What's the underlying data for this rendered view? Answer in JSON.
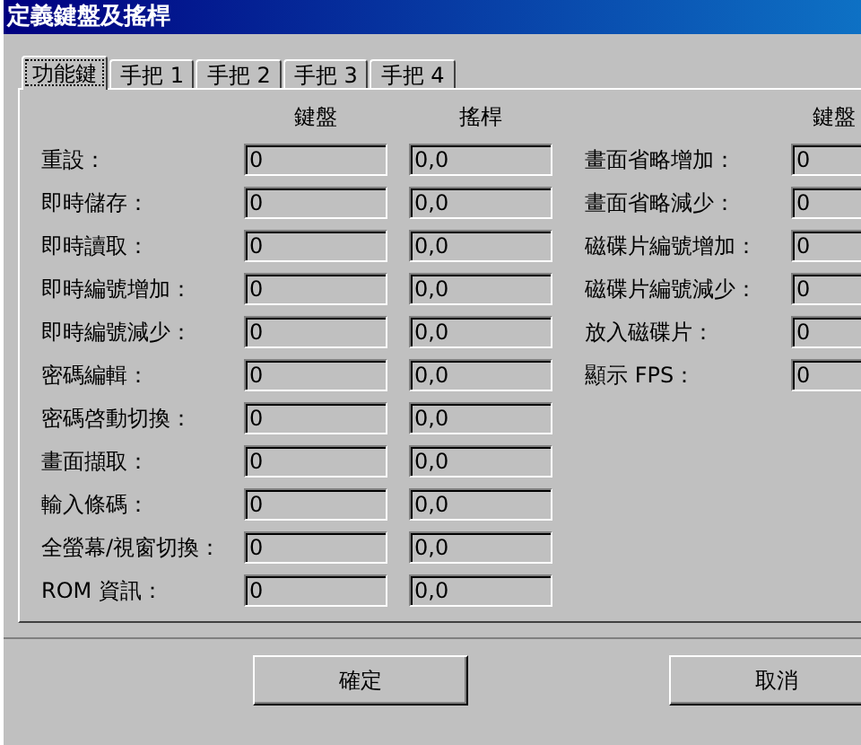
{
  "window": {
    "title": "定義鍵盤及搖桿"
  },
  "tabs": [
    {
      "label": "功能鍵",
      "selected": true
    },
    {
      "label": "手把 1",
      "selected": false
    },
    {
      "label": "手把 2",
      "selected": false
    },
    {
      "label": "手把 3",
      "selected": false
    },
    {
      "label": "手把 4",
      "selected": false
    }
  ],
  "left_group": {
    "keyboard_header": "鍵盤",
    "joystick_header": "搖桿",
    "rows": [
      {
        "label": "重設：",
        "keyboard": "0",
        "joystick": "0,0"
      },
      {
        "label": "即時儲存：",
        "keyboard": "0",
        "joystick": "0,0"
      },
      {
        "label": "即時讀取：",
        "keyboard": "0",
        "joystick": "0,0"
      },
      {
        "label": "即時編號增加：",
        "keyboard": "0",
        "joystick": "0,0"
      },
      {
        "label": "即時編號減少：",
        "keyboard": "0",
        "joystick": "0,0"
      },
      {
        "label": "密碼編輯：",
        "keyboard": "0",
        "joystick": "0,0"
      },
      {
        "label": "密碼啓動切換：",
        "keyboard": "0",
        "joystick": "0,0"
      },
      {
        "label": "畫面擷取：",
        "keyboard": "0",
        "joystick": "0,0"
      },
      {
        "label": "輸入條碼：",
        "keyboard": "0",
        "joystick": "0,0"
      },
      {
        "label": "全螢幕/視窗切換：",
        "keyboard": "0",
        "joystick": "0,0"
      },
      {
        "label": "ROM 資訊：",
        "keyboard": "0",
        "joystick": "0,0"
      }
    ]
  },
  "right_group": {
    "keyboard_header": "鍵盤",
    "rows": [
      {
        "label": "畫面省略增加：",
        "keyboard": "0"
      },
      {
        "label": "畫面省略減少：",
        "keyboard": "0"
      },
      {
        "label": "磁碟片編號增加：",
        "keyboard": "0"
      },
      {
        "label": "磁碟片編號減少：",
        "keyboard": "0"
      },
      {
        "label": "放入磁碟片：",
        "keyboard": "0"
      },
      {
        "label": "顯示 FPS：",
        "keyboard": "0"
      }
    ]
  },
  "buttons": [
    "確定",
    "取消"
  ]
}
